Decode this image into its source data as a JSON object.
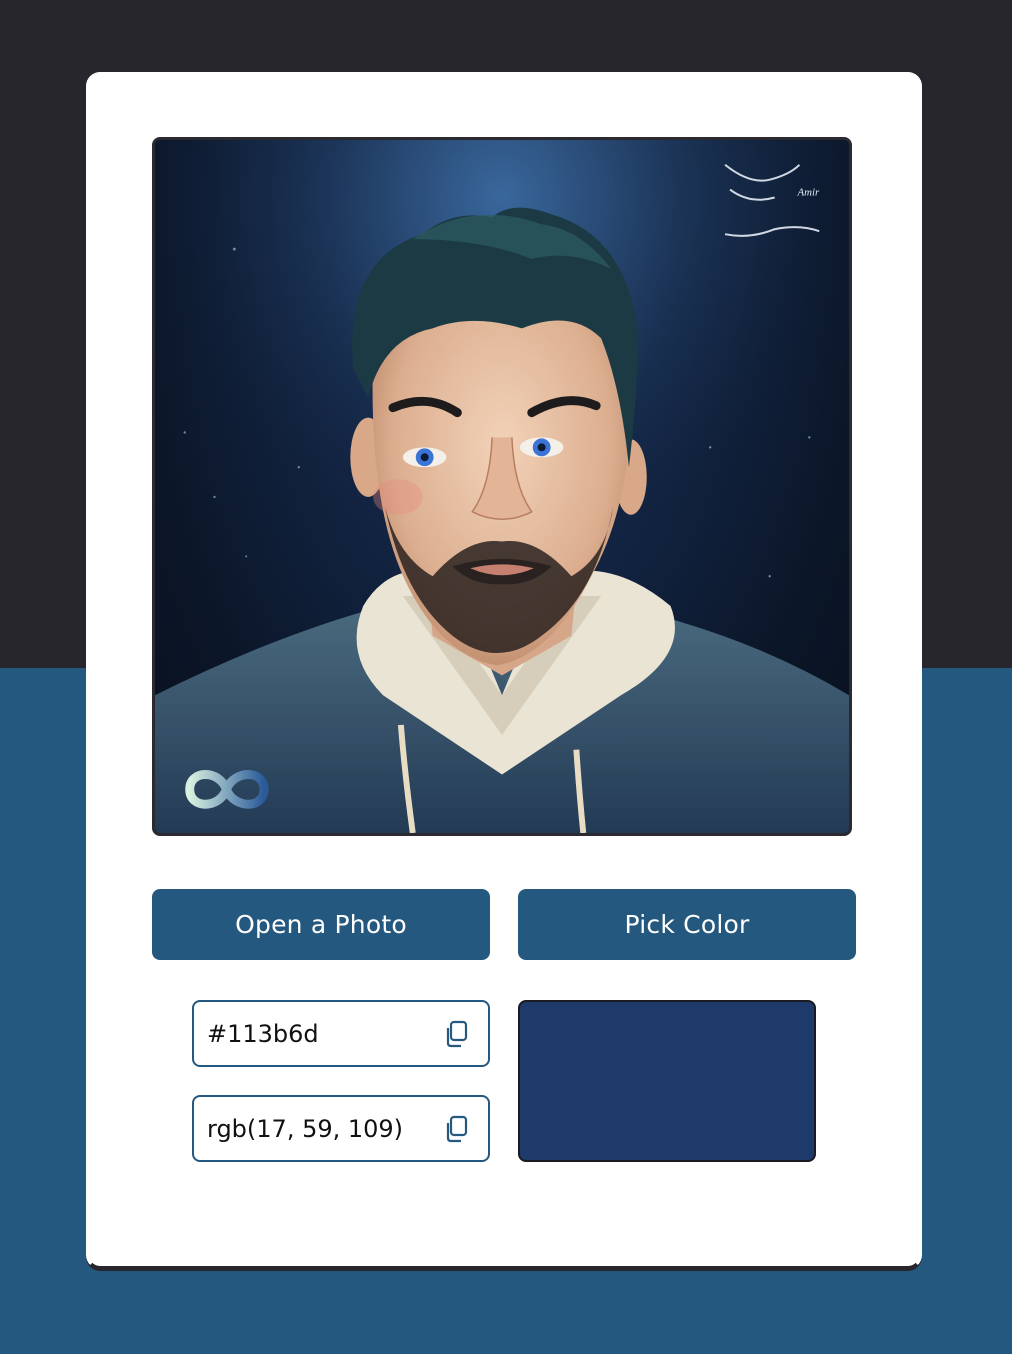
{
  "buttons": {
    "open_label": "Open a Photo",
    "pick_label": "Pick Color"
  },
  "color": {
    "hex": "#113b6d",
    "rgb": "rgb(17, 59, 109)",
    "swatch_hex": "#1e3a6b"
  },
  "icons": {
    "copy": "copy-icon",
    "logo": "infinity-logo-icon"
  },
  "theme": {
    "primary": "#25587f",
    "dark": "#26262c"
  }
}
